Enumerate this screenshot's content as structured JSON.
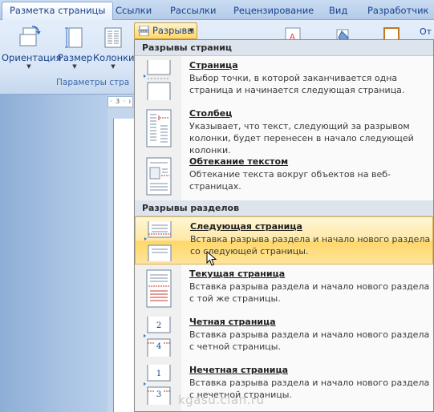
{
  "tabs": [
    {
      "label": "Разметка страницы",
      "active": true
    },
    {
      "label": "Ссылки"
    },
    {
      "label": "Рассылки"
    },
    {
      "label": "Рецензирование"
    },
    {
      "label": "Вид"
    },
    {
      "label": "Разработчик"
    }
  ],
  "ribbon": {
    "orientation_label": "Ориентация",
    "size_label": "Размер",
    "columns_label": "Колонки",
    "group_label": "Параметры стра",
    "breaks_label": "Разрывы",
    "ot_label": "От"
  },
  "ruler_text": "· 3 · ı",
  "menu": {
    "page_breaks_header": "Разрывы страниц",
    "section_breaks_header": "Разрывы разделов",
    "items": [
      {
        "title": "Страница",
        "desc": "Выбор точки, в которой заканчивается одна страница и начинается следующая страница."
      },
      {
        "title": "Столбец",
        "desc": "Указывает, что текст, следующий за разрывом колонки, будет перенесен в начало следующей колонки."
      },
      {
        "title": "Обтекание текстом",
        "desc": "Обтекание текста вокруг объектов на веб-страницах."
      },
      {
        "title": "Следующая страница",
        "desc": "Вставка разрыва раздела и начало нового раздела со следующей страницы.",
        "highlighted": true
      },
      {
        "title": "Текущая страница",
        "desc": "Вставка разрыва раздела и начало нового раздела с той же страницы."
      },
      {
        "title": "Четная страница",
        "desc": "Вставка разрыва раздела и начало нового раздела с четной страницы.",
        "thumb_numbers": [
          "2",
          "4"
        ]
      },
      {
        "title": "Нечетная страница",
        "desc": "Вставка разрыва раздела и начало нового раздела с нечетной страницы.",
        "thumb_numbers": [
          "1",
          "3"
        ]
      }
    ]
  },
  "watermark": "kgasu.clan.ru",
  "colors": {
    "accent": "#15428b",
    "highlight": "#ffd769",
    "break_mark": "#c0392b"
  }
}
